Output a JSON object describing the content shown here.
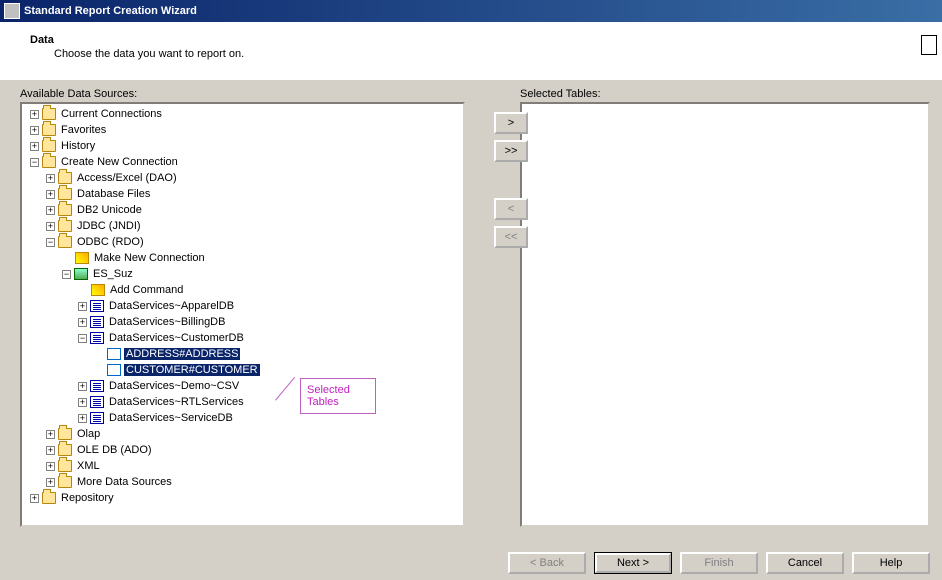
{
  "window": {
    "title": "Standard Report Creation Wizard"
  },
  "header": {
    "title": "Data",
    "subtitle": "Choose the data you want to report on."
  },
  "labels": {
    "available": "Available Data Sources:",
    "selected": "Selected Tables:"
  },
  "tree": {
    "root": [
      {
        "label": "Current Connections"
      },
      {
        "label": "Favorites"
      },
      {
        "label": "History"
      },
      {
        "label": "Create New Connection",
        "children": [
          {
            "label": "Access/Excel (DAO)"
          },
          {
            "label": "Database Files"
          },
          {
            "label": "DB2 Unicode"
          },
          {
            "label": "JDBC (JNDI)"
          },
          {
            "label": "ODBC (RDO)",
            "children": [
              {
                "label": "Make New Connection",
                "icon": "wand"
              },
              {
                "label": "ES_Suz",
                "icon": "conn",
                "children": [
                  {
                    "label": "Add Command",
                    "icon": "wand"
                  },
                  {
                    "label": "DataServices~ApparelDB",
                    "icon": "db"
                  },
                  {
                    "label": "DataServices~BillingDB",
                    "icon": "db"
                  },
                  {
                    "label": "DataServices~CustomerDB",
                    "icon": "db",
                    "children": [
                      {
                        "label": "ADDRESS#ADDRESS",
                        "icon": "tbl",
                        "selected": true
                      },
                      {
                        "label": "CUSTOMER#CUSTOMER",
                        "icon": "tbl",
                        "selected": true
                      }
                    ]
                  },
                  {
                    "label": "DataServices~Demo~CSV",
                    "icon": "db"
                  },
                  {
                    "label": "DataServices~RTLServices",
                    "icon": "db"
                  },
                  {
                    "label": "DataServices~ServiceDB",
                    "icon": "db"
                  }
                ]
              }
            ]
          },
          {
            "label": "Olap"
          },
          {
            "label": "OLE DB (ADO)"
          },
          {
            "label": "XML"
          },
          {
            "label": "More Data Sources"
          }
        ]
      },
      {
        "label": "Repository"
      }
    ]
  },
  "callout": {
    "line1": "Selected",
    "line2": "Tables"
  },
  "mid": {
    "add": ">",
    "addall": ">>",
    "remove": "<",
    "removeall": "<<"
  },
  "buttons": {
    "back": "< Back",
    "next": "Next >",
    "finish": "Finish",
    "cancel": "Cancel",
    "help": "Help"
  }
}
